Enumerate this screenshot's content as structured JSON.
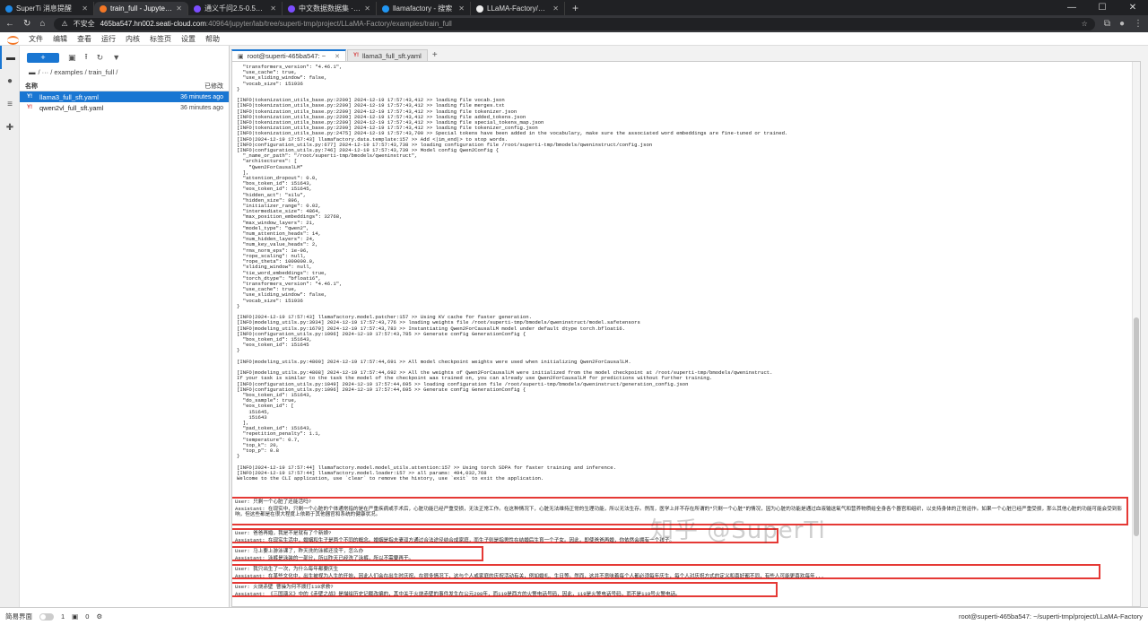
{
  "browser": {
    "tabs": [
      {
        "label": "SuperTi 消息提醒",
        "color": "#1e88e5"
      },
      {
        "label": "train_full - JupyterLab",
        "color": "#f37726"
      },
      {
        "label": "通义千问2.5-0.5B-Instruct · 模型库",
        "color": "#7c4dff"
      },
      {
        "label": "中文数据数据集 · 数据集",
        "color": "#7c4dff"
      },
      {
        "label": "llamafactory - 搜索",
        "color": "#2196f3"
      },
      {
        "label": "LLaMA-Factory/examples/inference...",
        "color": "#eeeeee"
      }
    ],
    "new_tab": "+",
    "security": "不安全",
    "host": "465ba547.hn002.seati-cloud.com",
    "path": ":40964/jupyter/lab/tree/superti-tmp/project/LLaMA-Factory/examples/train_full"
  },
  "menu": [
    "文件",
    "编辑",
    "查看",
    "运行",
    "内核",
    "标签页",
    "设置",
    "帮助"
  ],
  "filebrowser": {
    "new_label": "+",
    "breadcrumb": "/ ··· / examples / train_full /",
    "col_name": "名称",
    "col_modified": "已修改",
    "files": [
      {
        "name": "llama3_full_sft.yaml",
        "modified": "36 minutes ago"
      },
      {
        "name": "qwen2vl_full_sft.yaml",
        "modified": "36 minutes ago"
      }
    ]
  },
  "doctabs": [
    {
      "label": "root@superti-465ba547: ~"
    },
    {
      "label": "llama3_full_sft.yaml"
    }
  ],
  "terminal_lines": [
    "  \"transformers_version\": \"4.46.1\",",
    "  \"use_cache\": true,",
    "  \"use_sliding_window\": false,",
    "  \"vocab_size\": 151936",
    "}",
    "",
    "[INFO|tokenization_utils_base.py:2209] 2024-12-19 17:57:43,412 >> loading file vocab.json",
    "[INFO|tokenization_utils_base.py:2209] 2024-12-19 17:57:43,412 >> loading file merges.txt",
    "[INFO|tokenization_utils_base.py:2209] 2024-12-19 17:57:43,412 >> loading file tokenizer.json",
    "[INFO|tokenization_utils_base.py:2209] 2024-12-19 17:57:43,412 >> loading file added_tokens.json",
    "[INFO|tokenization_utils_base.py:2209] 2024-12-19 17:57:43,412 >> loading file special_tokens_map.json",
    "[INFO|tokenization_utils_base.py:2209] 2024-12-19 17:57:43,412 >> loading file tokenizer_config.json",
    "[INFO|tokenization_utils_base.py:2475] 2024-12-19 17:57:43,700 >> Special tokens have been added in the vocabulary, make sure the associated word embeddings are fine-tuned or trained.",
    "[INFO|2024-12-19 17:57:43] llamafactory.data.template:157 >> Add <|im_end|> to stop words.",
    "[INFO|configuration_utils.py:677] 2024-12-19 17:57:43,738 >> loading configuration file /root/superti-tmp/bmodels/qweninstruct/config.json",
    "[INFO|configuration_utils.py:746] 2024-12-19 17:57:43,739 >> Model config Qwen2Config {",
    "  \"_name_or_path\": \"/root/superti-tmp/bmodels/qweninstruct\",",
    "  \"architectures\": [",
    "    \"Qwen2ForCausalLM\"",
    "  ],",
    "  \"attention_dropout\": 0.0,",
    "  \"bos_token_id\": 151643,",
    "  \"eos_token_id\": 151645,",
    "  \"hidden_act\": \"silu\",",
    "  \"hidden_size\": 896,",
    "  \"initializer_range\": 0.02,",
    "  \"intermediate_size\": 4864,",
    "  \"max_position_embeddings\": 32768,",
    "  \"max_window_layers\": 21,",
    "  \"model_type\": \"qwen2\",",
    "  \"num_attention_heads\": 14,",
    "  \"num_hidden_layers\": 24,",
    "  \"num_key_value_heads\": 2,",
    "  \"rms_norm_eps\": 1e-06,",
    "  \"rope_scaling\": null,",
    "  \"rope_theta\": 1000000.0,",
    "  \"sliding_window\": null,",
    "  \"tie_word_embeddings\": true,",
    "  \"torch_dtype\": \"bfloat16\",",
    "  \"transformers_version\": \"4.46.1\",",
    "  \"use_cache\": true,",
    "  \"use_sliding_window\": false,",
    "  \"vocab_size\": 151936",
    "}",
    "",
    "[INFO|2024-12-19 17:57:43] llamafactory.model.patcher:157 >> Using KV cache for faster generation.",
    "[INFO|modeling_utils.py:3934] 2024-12-19 17:57:43,776 >> loading weights file /root/superti-tmp/bmodels/qweninstruct/model.safetensors",
    "[INFO|modeling_utils.py:1670] 2024-12-19 17:57:43,783 >> Instantiating Qwen2ForCausalLM model under default dtype torch.bfloat16.",
    "[INFO|configuration_utils.py:1096] 2024-12-19 17:57:43,785 >> Generate config GenerationConfig {",
    "  \"bos_token_id\": 151643,",
    "  \"eos_token_id\": 151645",
    "}",
    "",
    "[INFO|modeling_utils.py:4800] 2024-12-19 17:57:44,691 >> All model checkpoint weights were used when initializing Qwen2ForCausalLM.",
    "",
    "[INFO|modeling_utils.py:4808] 2024-12-19 17:57:44,692 >> All the weights of Qwen2ForCausalLM were initialized from the model checkpoint at /root/superti-tmp/bmodels/qweninstruct.",
    "If your task is similar to the task the model of the checkpoint was trained on, you can already use Qwen2ForCausalLM for predictions without further training.",
    "[INFO|configuration_utils.py:1049] 2024-12-19 17:57:44,695 >> loading configuration file /root/superti-tmp/bmodels/qweninstruct/generation_config.json",
    "[INFO|configuration_utils.py:1096] 2024-12-19 17:57:44,695 >> Generate config GenerationConfig {",
    "  \"bos_token_id\": 151643,",
    "  \"do_sample\": true,",
    "  \"eos_token_id\": [",
    "    151645,",
    "    151643",
    "  ],",
    "  \"pad_token_id\": 151643,",
    "  \"repetition_penalty\": 1.1,",
    "  \"temperature\": 0.7,",
    "  \"top_k\": 20,",
    "  \"top_p\": 0.8",
    "}",
    "",
    "[INFO|2024-12-19 17:57:44] llamafactory.model.model_utils.attention:157 >> Using torch SDPA for faster training and inference.",
    "[INFO|2024-12-19 17:57:44] llamafactory.model.loader:157 >> all params: 494,032,768",
    "Welcome to the CLI application, use `clear` to remove the history, use `exit` to exit the application."
  ],
  "qa_blocks": [
    {
      "user": "User: 只剩一个心脏了还能活吗?",
      "assistant": "Assistant: 在现实中，只剩一个心脏的个体通常指的是在严重疾病或手术后，心脏功能已经严重受损，无法正常工作。在这种情况下，心脏无法维持正常的生理功能，所以无法生存。然而，医学上并不存在所谓的“只剩一个心脏”的情况，因为心脏的功能是通过血液输送氧气和营养物质给全身各个器官和组织，以支持身体的正常运作。如果一个心脏已经严重受损，那么其他心脏的功能可能会受到影响，但这些都是在很大程度上依赖于其他器官和系统的健康状况。"
    },
    {
      "user": "User: 爸爸再婚，我是不是就有了个新娘?",
      "assistant": "Assistant: 在现实生活中，婚姻和生子是两个不同的概念。婚姻是指夫妻双方通过合法途径结合成家庭，而生子则是指男性在结婚后生育一个子女。因此，即使爸爸再婚，你依然会拥有一个孩子。"
    },
    {
      "user": "User: 马上要上游泳课了，昨天洗的泳裤还没干，怎么办",
      "assistant": "Assistant: 泳裤是泳装的一部分，所以昨天已经洗了泳裤，所以不需要再干。"
    },
    {
      "user": "User: 我只出生了一次，为什么每年都要庆生",
      "assistant": "Assistant: 在某些文化中，出生被视为人生的开始，因此人们会在出生时庆祝。在很多情况下，这与个人或家庭的庆祝活动有关，例如婚礼、生日等。然而，这并不意味着每个人都必须每年庆生，每个人对庆祝方式的定义和喜好都不同，有些人可能更喜欢每年..."
    },
    {
      "user": "User: 火烧赤壁 曹操为何不拨打119求救?",
      "assistant": "Assistant: 《三国演义》中的《赤壁之战》是描绘历史记载改编的，其中关于火烧赤壁的事件发生在公元208年，而119是西方的火警电话号码，因此，119是火警电话号码，而不是119号火警电话。"
    }
  ],
  "watermark": "知乎 @SuperTi",
  "status": {
    "mode_label": "简易界面",
    "count1": "1",
    "count2": "0",
    "right": "root@superti-465ba547: ~/superti-tmp/project/LLaMA-Factory"
  }
}
